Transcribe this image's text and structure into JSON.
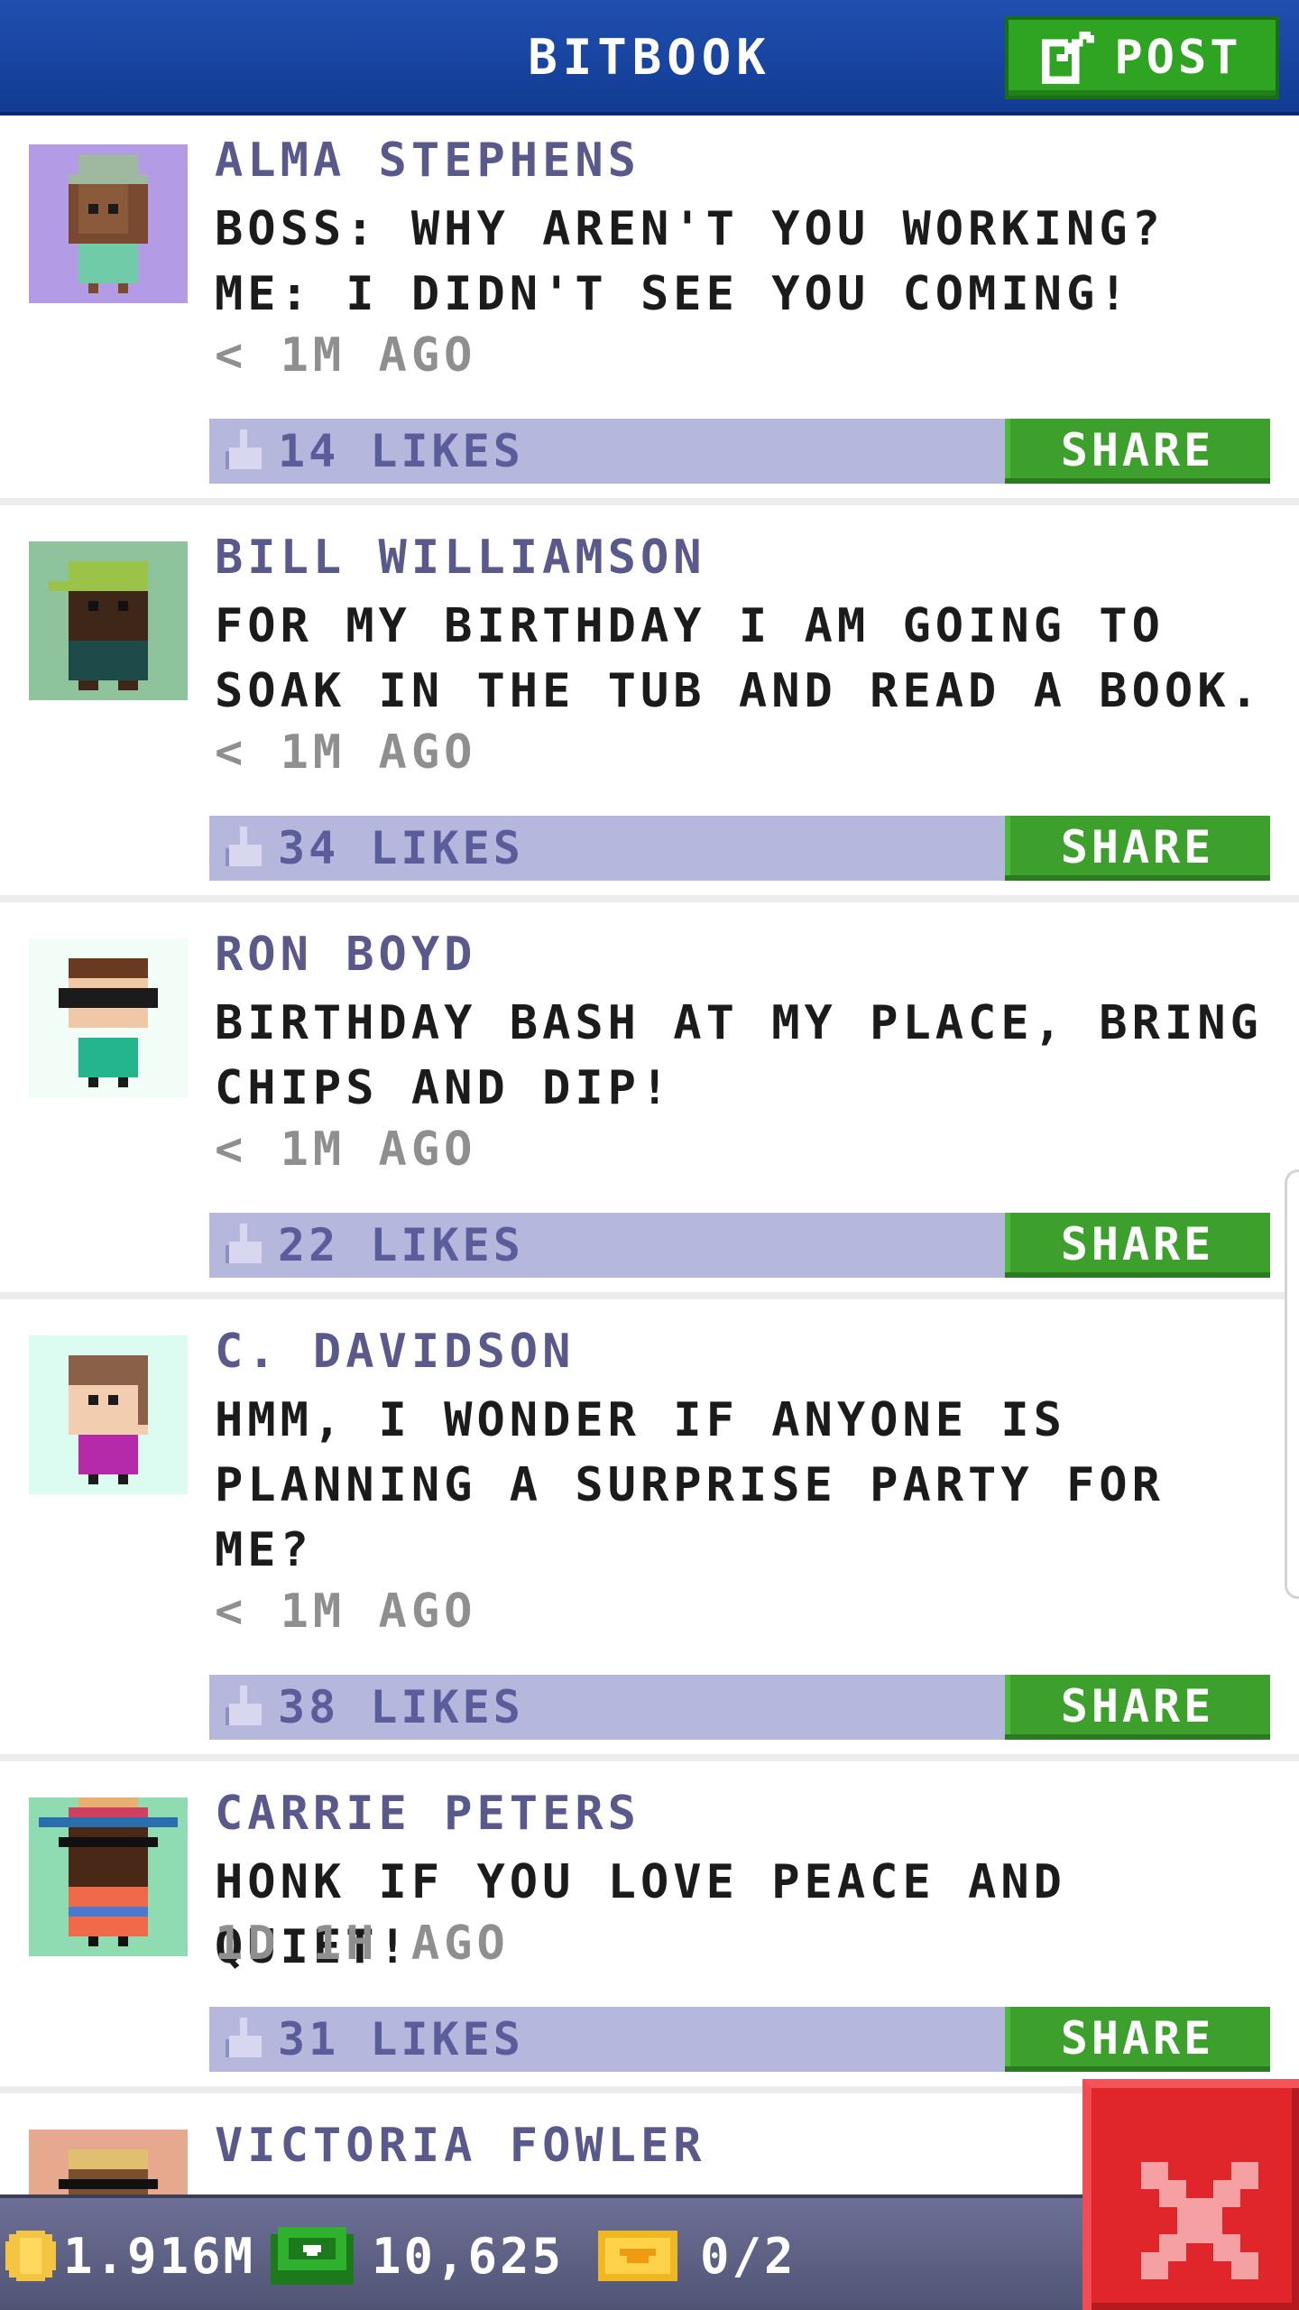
{
  "header": {
    "title": "BITBOOK",
    "post_label": "POST"
  },
  "posts": [
    {
      "author": "ALMA STEPHENS",
      "text": "BOSS: WHY AREN'T YOU WORKING? ME: I DIDN'T SEE YOU COMING!",
      "time": "< 1M AGO",
      "likes": "14 LIKES",
      "share_label": "SHARE",
      "avatar_bg": "#b39be6"
    },
    {
      "author": "BILL WILLIAMSON",
      "text": "FOR MY BIRTHDAY I AM GOING TO SOAK IN THE TUB AND READ A BOOK.",
      "time": "< 1M AGO",
      "likes": "34 LIKES",
      "share_label": "SHARE",
      "avatar_bg": "#8fc39b"
    },
    {
      "author": "RON BOYD",
      "text": "BIRTHDAY BASH AT MY PLACE, BRING CHIPS AND DIP!",
      "time": "< 1M AGO",
      "likes": "22 LIKES",
      "share_label": "SHARE",
      "avatar_bg": "#f2fdf8"
    },
    {
      "author": "C. DAVIDSON",
      "text": "HMM, I WONDER IF ANYONE IS PLANNING A SURPRISE PARTY FOR ME?",
      "time": "< 1M AGO",
      "likes": "38 LIKES",
      "share_label": "SHARE",
      "avatar_bg": "#dcfbf1"
    },
    {
      "author": "CARRIE PETERS",
      "text": "HONK IF YOU LOVE PEACE AND QUIET!",
      "time": "1D 1H AGO",
      "likes": "31 LIKES",
      "share_label": "SHARE",
      "avatar_bg": "#8fdcb2"
    },
    {
      "author": "VICTORIA FOWLER",
      "avatar_bg": "#e6a98f"
    }
  ],
  "bottom_bar": {
    "coins": "1.916M",
    "bux": "10,625",
    "tickets": "0/2"
  },
  "colors": {
    "header": "#1a4aa8",
    "share_green": "#3da02d",
    "likes_bar": "#b6b7dc",
    "close_red": "#e0262a"
  },
  "icons": {
    "post": "edit-icon",
    "like": "thumbs-up-icon",
    "coin": "coin-icon",
    "bux": "bux-icon",
    "ticket": "ticket-icon",
    "close": "close-icon"
  }
}
